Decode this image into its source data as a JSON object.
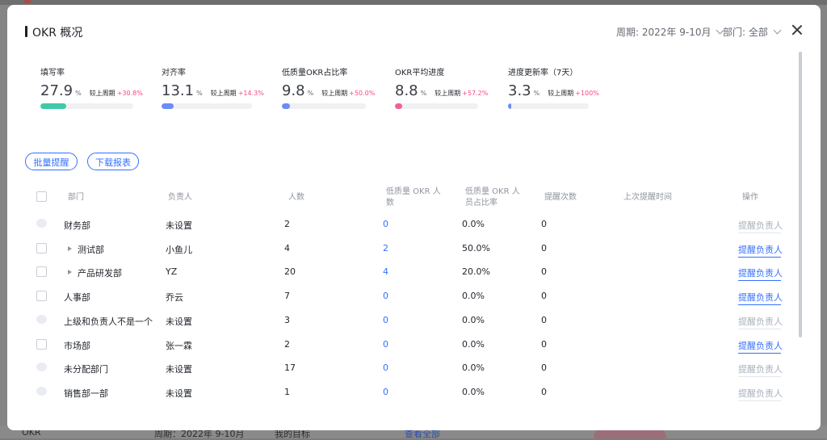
{
  "modal": {
    "title": "OKR 概况",
    "period_label": "周期:",
    "period_value": "2022年 9-10月",
    "department_label": "部门:",
    "department_value": "全部"
  },
  "metrics": [
    {
      "label": "填写率",
      "value": "27.9",
      "unit": "%",
      "compare_label": "较上周期",
      "change": "+30.8%",
      "progress": 0.279,
      "color": "#3ec9a7"
    },
    {
      "label": "对齐率",
      "value": "13.1",
      "unit": "%",
      "compare_label": "较上周期",
      "change": "+14.3%",
      "progress": 0.131,
      "color": "#6a8cf6"
    },
    {
      "label": "低质量OKR占比率",
      "value": "9.8",
      "unit": "%",
      "compare_label": "较上周期",
      "change": "+50.0%",
      "progress": 0.098,
      "color": "#6a8cf6"
    },
    {
      "label": "OKR平均进度",
      "value": "8.8",
      "unit": "%",
      "compare_label": "较上周期",
      "change": "+57.2%",
      "progress": 0.088,
      "color": "#f0609a"
    },
    {
      "label": "进度更新率（7天）",
      "value": "3.3",
      "unit": "%",
      "compare_label": "较上周期",
      "change": "+100%",
      "progress": 0.033,
      "color": "#6a8cf6"
    }
  ],
  "buttons": {
    "batch_remind": "批量提醒",
    "download_report": "下载报表"
  },
  "table": {
    "headers": {
      "department": "部门",
      "owner": "负责人",
      "count": "人数",
      "low_okr_line1": "低质量 OKR 人",
      "low_okr_line2": "数",
      "low_ratio_line1": "低质量 OKR 人",
      "low_ratio_line2": "员占比率",
      "remind_count": "提醒次数",
      "last_remind": "上次提醒时间",
      "action": "操作"
    },
    "rows": [
      {
        "department": "财务部",
        "owner": "未设置",
        "count": "2",
        "low_okr": "0",
        "low_ratio": "0.0%",
        "remind_count": "0",
        "action": "提醒负责人",
        "enabled": false,
        "expandable": false
      },
      {
        "department": "测试部",
        "owner": "小鱼儿",
        "count": "4",
        "low_okr": "2",
        "low_ratio": "50.0%",
        "remind_count": "0",
        "action": "提醒负责人",
        "enabled": true,
        "expandable": true
      },
      {
        "department": "产品研发部",
        "owner": "YZ",
        "count": "20",
        "low_okr": "4",
        "low_ratio": "20.0%",
        "remind_count": "0",
        "action": "提醒负责人",
        "enabled": true,
        "expandable": true
      },
      {
        "department": "人事部",
        "owner": "乔云",
        "count": "7",
        "low_okr": "0",
        "low_ratio": "0.0%",
        "remind_count": "0",
        "action": "提醒负责人",
        "enabled": true,
        "expandable": false
      },
      {
        "department": "上级和负责人不是一个",
        "owner": "未设置",
        "count": "3",
        "low_okr": "0",
        "low_ratio": "0.0%",
        "remind_count": "0",
        "action": "提醒负责人",
        "enabled": false,
        "expandable": false
      },
      {
        "department": "市场部",
        "owner": "张一霖",
        "count": "2",
        "low_okr": "0",
        "low_ratio": "0.0%",
        "remind_count": "0",
        "action": "提醒负责人",
        "enabled": true,
        "expandable": false
      },
      {
        "department": "未分配部门",
        "owner": "未设置",
        "count": "17",
        "low_okr": "0",
        "low_ratio": "0.0%",
        "remind_count": "0",
        "action": "提醒负责人",
        "enabled": false,
        "expandable": false
      },
      {
        "department": "销售部一部",
        "owner": "未设置",
        "count": "1",
        "low_okr": "0",
        "low_ratio": "0.0%",
        "remind_count": "0",
        "action": "提醒负责人",
        "enabled": false,
        "expandable": false
      }
    ]
  },
  "background": {
    "okr_label": "OKR",
    "period": "周期：2022年 9-10月",
    "my_goals": "我的目标",
    "view_all": "查看全部"
  }
}
